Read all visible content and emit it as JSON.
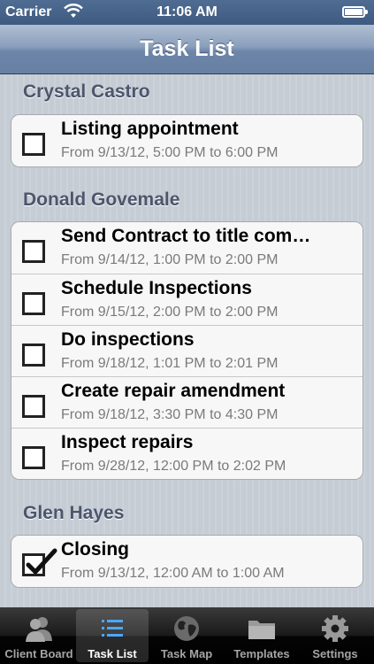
{
  "status_bar": {
    "carrier": "Carrier",
    "time": "11:06 AM"
  },
  "nav": {
    "title": "Task List"
  },
  "sections": [
    {
      "name": "Crystal Castro",
      "tasks": [
        {
          "title": "Listing appointment",
          "time": "From 9/13/12, 5:00 PM to 6:00 PM",
          "checked": false
        }
      ]
    },
    {
      "name": "Donald Govemale",
      "tasks": [
        {
          "title": "Send Contract to title com…",
          "time": "From 9/14/12, 1:00 PM to 2:00 PM",
          "checked": false
        },
        {
          "title": "Schedule Inspections",
          "time": "From 9/15/12, 2:00 PM to 2:00 PM",
          "checked": false
        },
        {
          "title": "Do inspections",
          "time": "From 9/18/12, 1:01 PM to 2:01 PM",
          "checked": false
        },
        {
          "title": "Create repair amendment",
          "time": "From 9/18/12, 3:30 PM to 4:30 PM",
          "checked": false
        },
        {
          "title": "Inspect repairs",
          "time": "From 9/28/12, 12:00 PM to 2:02 PM",
          "checked": false
        }
      ]
    },
    {
      "name": "Glen Hayes",
      "tasks": [
        {
          "title": "Closing",
          "time": "From 9/13/12, 12:00 AM to 1:00 AM",
          "checked": true
        }
      ]
    }
  ],
  "tab_bar": {
    "tabs": [
      {
        "label": "Client Board",
        "icon": "clients-icon"
      },
      {
        "label": "Task List",
        "icon": "list-icon",
        "selected": true
      },
      {
        "label": "Task Map",
        "icon": "globe-icon"
      },
      {
        "label": "Templates",
        "icon": "folder-icon"
      },
      {
        "label": "Settings",
        "icon": "gear-icon"
      }
    ]
  }
}
